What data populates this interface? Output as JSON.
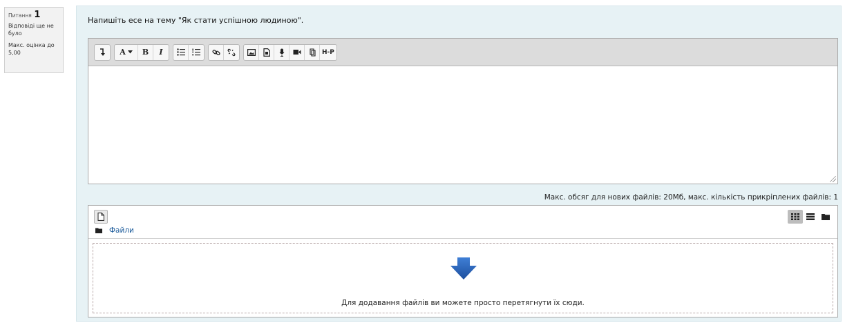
{
  "question": {
    "label": "Питання",
    "number": "1",
    "state": "Відповіді ще не було",
    "max_grade": "Макс. оцінка до 5,00",
    "text": "Напишіть есе на тему \"Як стати успішною людиною\"."
  },
  "toolbar": {
    "font_label": "A",
    "bold_label": "B",
    "italic_label": "I",
    "h5p_label": "H-P",
    "icons": [
      "collapse-icon",
      "font-color-icon",
      "bold-icon",
      "italic-icon",
      "unordered-list-icon",
      "ordered-list-icon",
      "link-icon",
      "unlink-icon",
      "image-icon",
      "media-icon",
      "record-audio-icon",
      "record-video-icon",
      "manage-files-icon",
      "h5p-icon"
    ]
  },
  "editor": {
    "content": ""
  },
  "files": {
    "limits": "Макс. обсяг для нових файлів: 20Мб, макс. кількість прикріплених файлів: 1",
    "folder_label": "Файли",
    "drop_text": "Для додавання файлів ви можете просто перетягнути їх сюди."
  },
  "colors": {
    "content_bg": "#e7f2f5",
    "link": "#1a5a9a",
    "drop_arrow": "#2a63b8"
  }
}
